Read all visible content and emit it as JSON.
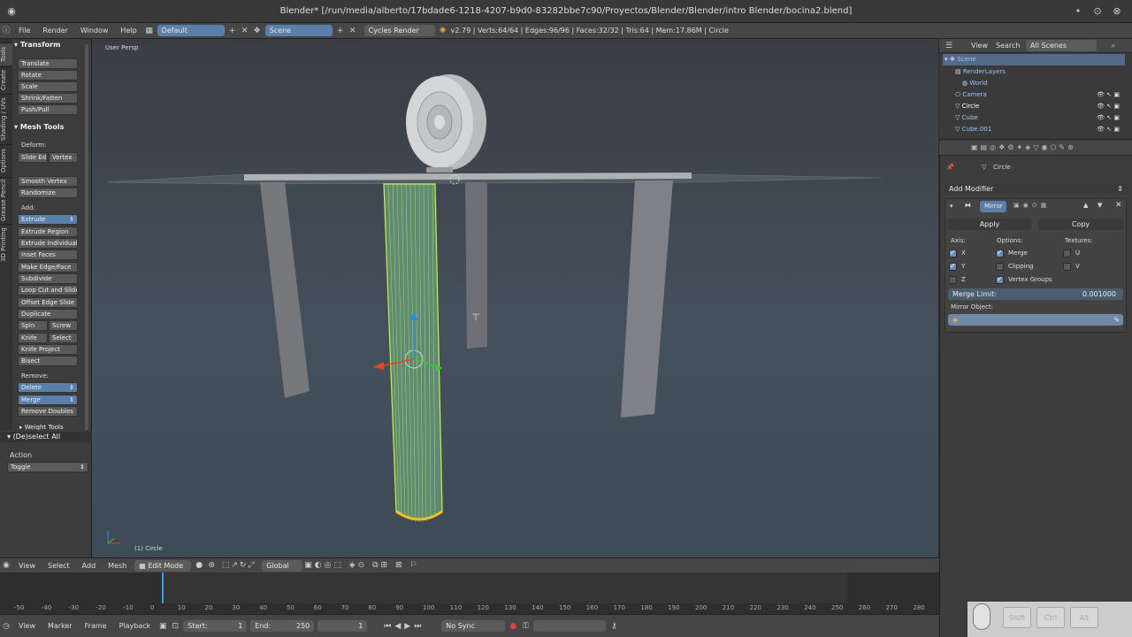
{
  "titlebar": {
    "title": "Blender* [/run/media/alberto/17bdade6-1218-4207-b9d0-83282bbe7c90/Proyectos/Blender/Blender/intro Blender/bocina2.blend]"
  },
  "info_header": {
    "menus": [
      "File",
      "Render",
      "Window",
      "Help"
    ],
    "screen_layout": "Default",
    "scene": "Scene",
    "engine": "Cycles Render",
    "stats": "v2.79 | Verts:64/64 | Edges:96/96 | Faces:32/32 | Tris:64 | Mem:17.86M | Circle"
  },
  "viewport": {
    "view_label": "User Persp",
    "object_label": "(1) Circle"
  },
  "toolshelf": {
    "tabs": [
      "Tools",
      "Create",
      "Shading / UVs",
      "Options",
      "Grease Pencil",
      "3D Printing"
    ],
    "transform": {
      "heading": "Transform",
      "buttons": [
        "Translate",
        "Rotate",
        "Scale",
        "Shrink/Fatten",
        "Push/Pull"
      ]
    },
    "mesh_tools": {
      "heading": "Mesh Tools",
      "deform_label": "Deform:",
      "slide_edge": "Slide Ed",
      "vertex": "Vertex",
      "smooth_vertex": "Smooth Vertex",
      "randomize": "Randomize",
      "add_label": "Add:",
      "extrude": "Extrude",
      "add_buttons": [
        "Extrude Region",
        "Extrude Individual",
        "Inset Faces",
        "Make Edge/Face",
        "Subdivide",
        "Loop Cut and Slide",
        "Offset Edge Slide",
        "Duplicate"
      ],
      "spin": "Spin",
      "screw": "Screw",
      "knife": "Knife",
      "select": "Select",
      "knife_project": "Knife Project",
      "bisect": "Bisect",
      "remove_label": "Remove:",
      "delete": "Delete",
      "merge": "Merge",
      "remove_doubles": "Remove Doubles",
      "weight_tools": "Weight Tools"
    }
  },
  "redo_panel": {
    "heading": "(De)select All",
    "action_label": "Action",
    "action_value": "Toggle"
  },
  "outliner": {
    "menus": [
      "View",
      "Search"
    ],
    "filter": "All Scenes",
    "items": [
      "Scene",
      "RenderLayers",
      "World",
      "Camera",
      "Circle",
      "Cube",
      "Cube.001"
    ]
  },
  "properties": {
    "object_name": "Circle",
    "add_modifier": "Add Modifier",
    "modifier_name": "Mirror",
    "apply": "Apply",
    "copy": "Copy",
    "axis_label": "Axis:",
    "options_label": "Options:",
    "textures_label": "Textures:",
    "axis": [
      {
        "label": "X",
        "checked": true
      },
      {
        "label": "Y",
        "checked": true
      },
      {
        "label": "Z",
        "checked": false
      }
    ],
    "options": [
      {
        "label": "Merge",
        "checked": true
      },
      {
        "label": "Clipping",
        "checked": false
      },
      {
        "label": "Vertex Groups",
        "checked": true
      }
    ],
    "textures": [
      {
        "label": "U",
        "checked": false
      },
      {
        "label": "V",
        "checked": false
      }
    ],
    "merge_limit_label": "Merge Limit:",
    "merge_limit_value": "0.001000",
    "mirror_object_label": "Mirror Object:"
  },
  "view3d_header": {
    "menus": [
      "View",
      "Select",
      "Add",
      "Mesh"
    ],
    "mode": "Edit Mode",
    "orientation": "Global"
  },
  "timeline": {
    "ruler_ticks": [
      "-50",
      "-40",
      "-30",
      "-20",
      "-10",
      "0",
      "10",
      "20",
      "30",
      "40",
      "50",
      "60",
      "70",
      "80",
      "90",
      "100",
      "110",
      "120",
      "130",
      "140",
      "150",
      "160",
      "170",
      "180",
      "190",
      "200",
      "210",
      "220",
      "230",
      "240",
      "250",
      "260",
      "270",
      "280"
    ],
    "menus": [
      "View",
      "Marker",
      "Frame",
      "Playback"
    ],
    "start_label": "Start:",
    "start_value": "1",
    "end_label": "End:",
    "end_value": "250",
    "current_frame": "1",
    "sync": "No Sync"
  },
  "key_overlay": {
    "keys": [
      "Shift",
      "Ctrl",
      "Alt"
    ]
  },
  "colors": {
    "selection": "#c8f040",
    "accent": "#5a7fa8",
    "viewport_bg": "#3e4a55"
  }
}
